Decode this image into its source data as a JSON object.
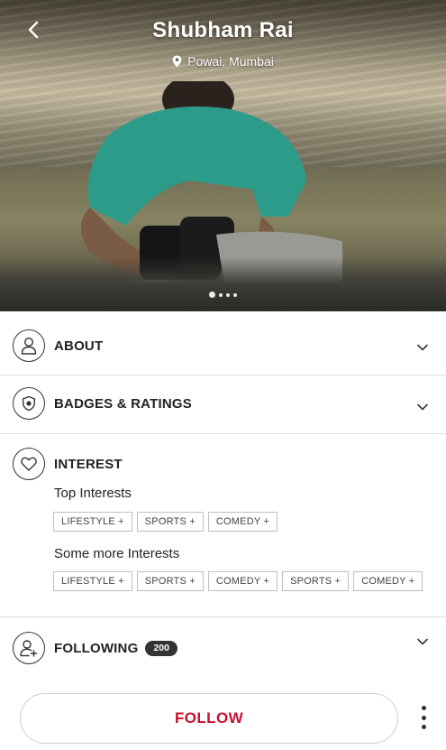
{
  "profile": {
    "name": "Shubham Rai",
    "location": "Powai, Mumbai",
    "photo_pages": 4,
    "active_photo": 1
  },
  "sections": {
    "about": {
      "title": "ABOUT"
    },
    "badges": {
      "title": "BADGES & RATINGS"
    },
    "interest": {
      "title": "INTEREST",
      "top_label": "Top Interests",
      "top_tags": [
        "LIFESTYLE +",
        "SPORTS +",
        "COMEDY +"
      ],
      "more_label": "Some more Interests",
      "more_tags": [
        "LIFESTYLE +",
        "SPORTS +",
        "COMEDY +",
        "SPORTS +",
        "COMEDY +"
      ]
    },
    "following": {
      "title": "FOLLOWING",
      "count": "200"
    }
  },
  "actions": {
    "follow_label": "FOLLOW"
  },
  "icons": {
    "back": "chevron-left-icon",
    "location": "location-pin-icon",
    "about": "user-icon",
    "badges": "badge-icon",
    "interest": "heart-icon",
    "following": "add-user-icon",
    "expand": "chevron-down-icon",
    "more": "more-vertical-icon"
  },
  "colors": {
    "accent": "#c8102e",
    "badge_bg": "#333333"
  }
}
